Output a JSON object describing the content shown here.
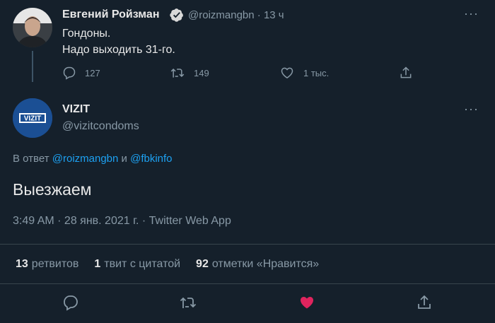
{
  "top_tweet": {
    "name": "Евгений Ройзман",
    "handle": "@roizmangbn",
    "time": "· 13 ч",
    "more": "···",
    "line1": "Гондоны.",
    "line2": "Надо выходить 31-го.",
    "counts": {
      "reply": "127",
      "retweet": "149",
      "like": "1 тыс."
    }
  },
  "main_tweet": {
    "name": "VIZIT",
    "handle": "@vizitcondoms",
    "avatar_text": "VIZIT",
    "more": "···",
    "reply_prefix": "В ответ",
    "reply_user1": "@roizmangbn",
    "reply_and": "и",
    "reply_user2": "@fbkinfo",
    "text": "Выезжаем",
    "meta": "3:49 AM · 28 янв. 2021 г. · Twitter Web App"
  },
  "stats": {
    "retweets_count": "13",
    "retweets_label": "ретвитов",
    "quotes_count": "1",
    "quotes_label": "твит с цитатой",
    "likes_count": "92",
    "likes_label": "отметки «Нравится»"
  },
  "colors": {
    "background": "#15202b",
    "accent": "#1da1f2",
    "like": "#e0245e",
    "muted": "#8899a6"
  },
  "icons": [
    "verified-icon",
    "reply-icon",
    "retweet-icon",
    "like-icon",
    "share-icon",
    "more-icon"
  ]
}
